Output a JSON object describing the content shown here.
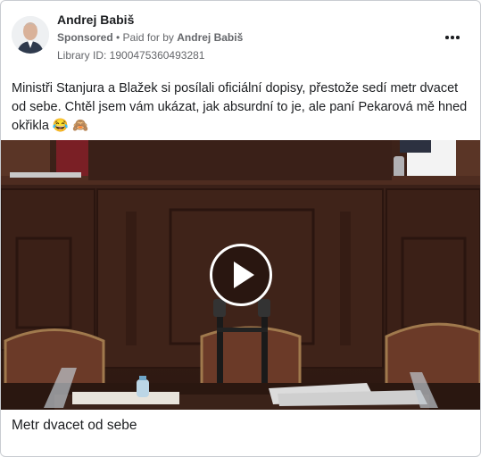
{
  "post": {
    "author": "Andrej Babiš",
    "sponsored_label": "Sponsored",
    "separator": " • ",
    "paid_for_prefix": "Paid for by ",
    "paid_for_name": "Andrej Babiš",
    "library_id": "Library ID: 1900475360493281",
    "text": "Ministři Stanjura a Blažek si posílali oficiální dopisy, přestože sedí metr dvacet od sebe. Chtěl jsem vám ukázat, jak absurdní to je, ale paní Pekarová mě hned okřikla 😂 🙈",
    "media_caption": "Metr dvacet od sebe"
  },
  "icons": {
    "more": "more-options-icon",
    "play": "play-icon"
  },
  "colors": {
    "text": "#1c1e21",
    "secondary": "#65676b",
    "wood": "#4a2a1e"
  }
}
